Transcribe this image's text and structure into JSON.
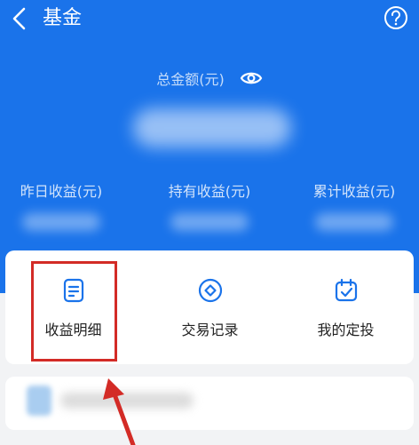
{
  "header": {
    "title": "基金",
    "back_icon": "chevron-left-icon",
    "help_icon": "question-circle-icon"
  },
  "summary": {
    "total_label": "总金额(元)",
    "eye_icon": "eye-icon"
  },
  "stats": [
    {
      "label": "昨日收益(元)"
    },
    {
      "label": "持有收益(元)"
    },
    {
      "label": "累计收益(元)"
    }
  ],
  "actions": [
    {
      "label": "收益明细",
      "icon": "document-list-icon"
    },
    {
      "label": "交易记录",
      "icon": "diamond-circle-icon"
    },
    {
      "label": "我的定投",
      "icon": "calendar-check-icon"
    }
  ],
  "colors": {
    "primary": "#1a73ea",
    "highlight": "#d32b26",
    "background": "#f2f3f5"
  }
}
